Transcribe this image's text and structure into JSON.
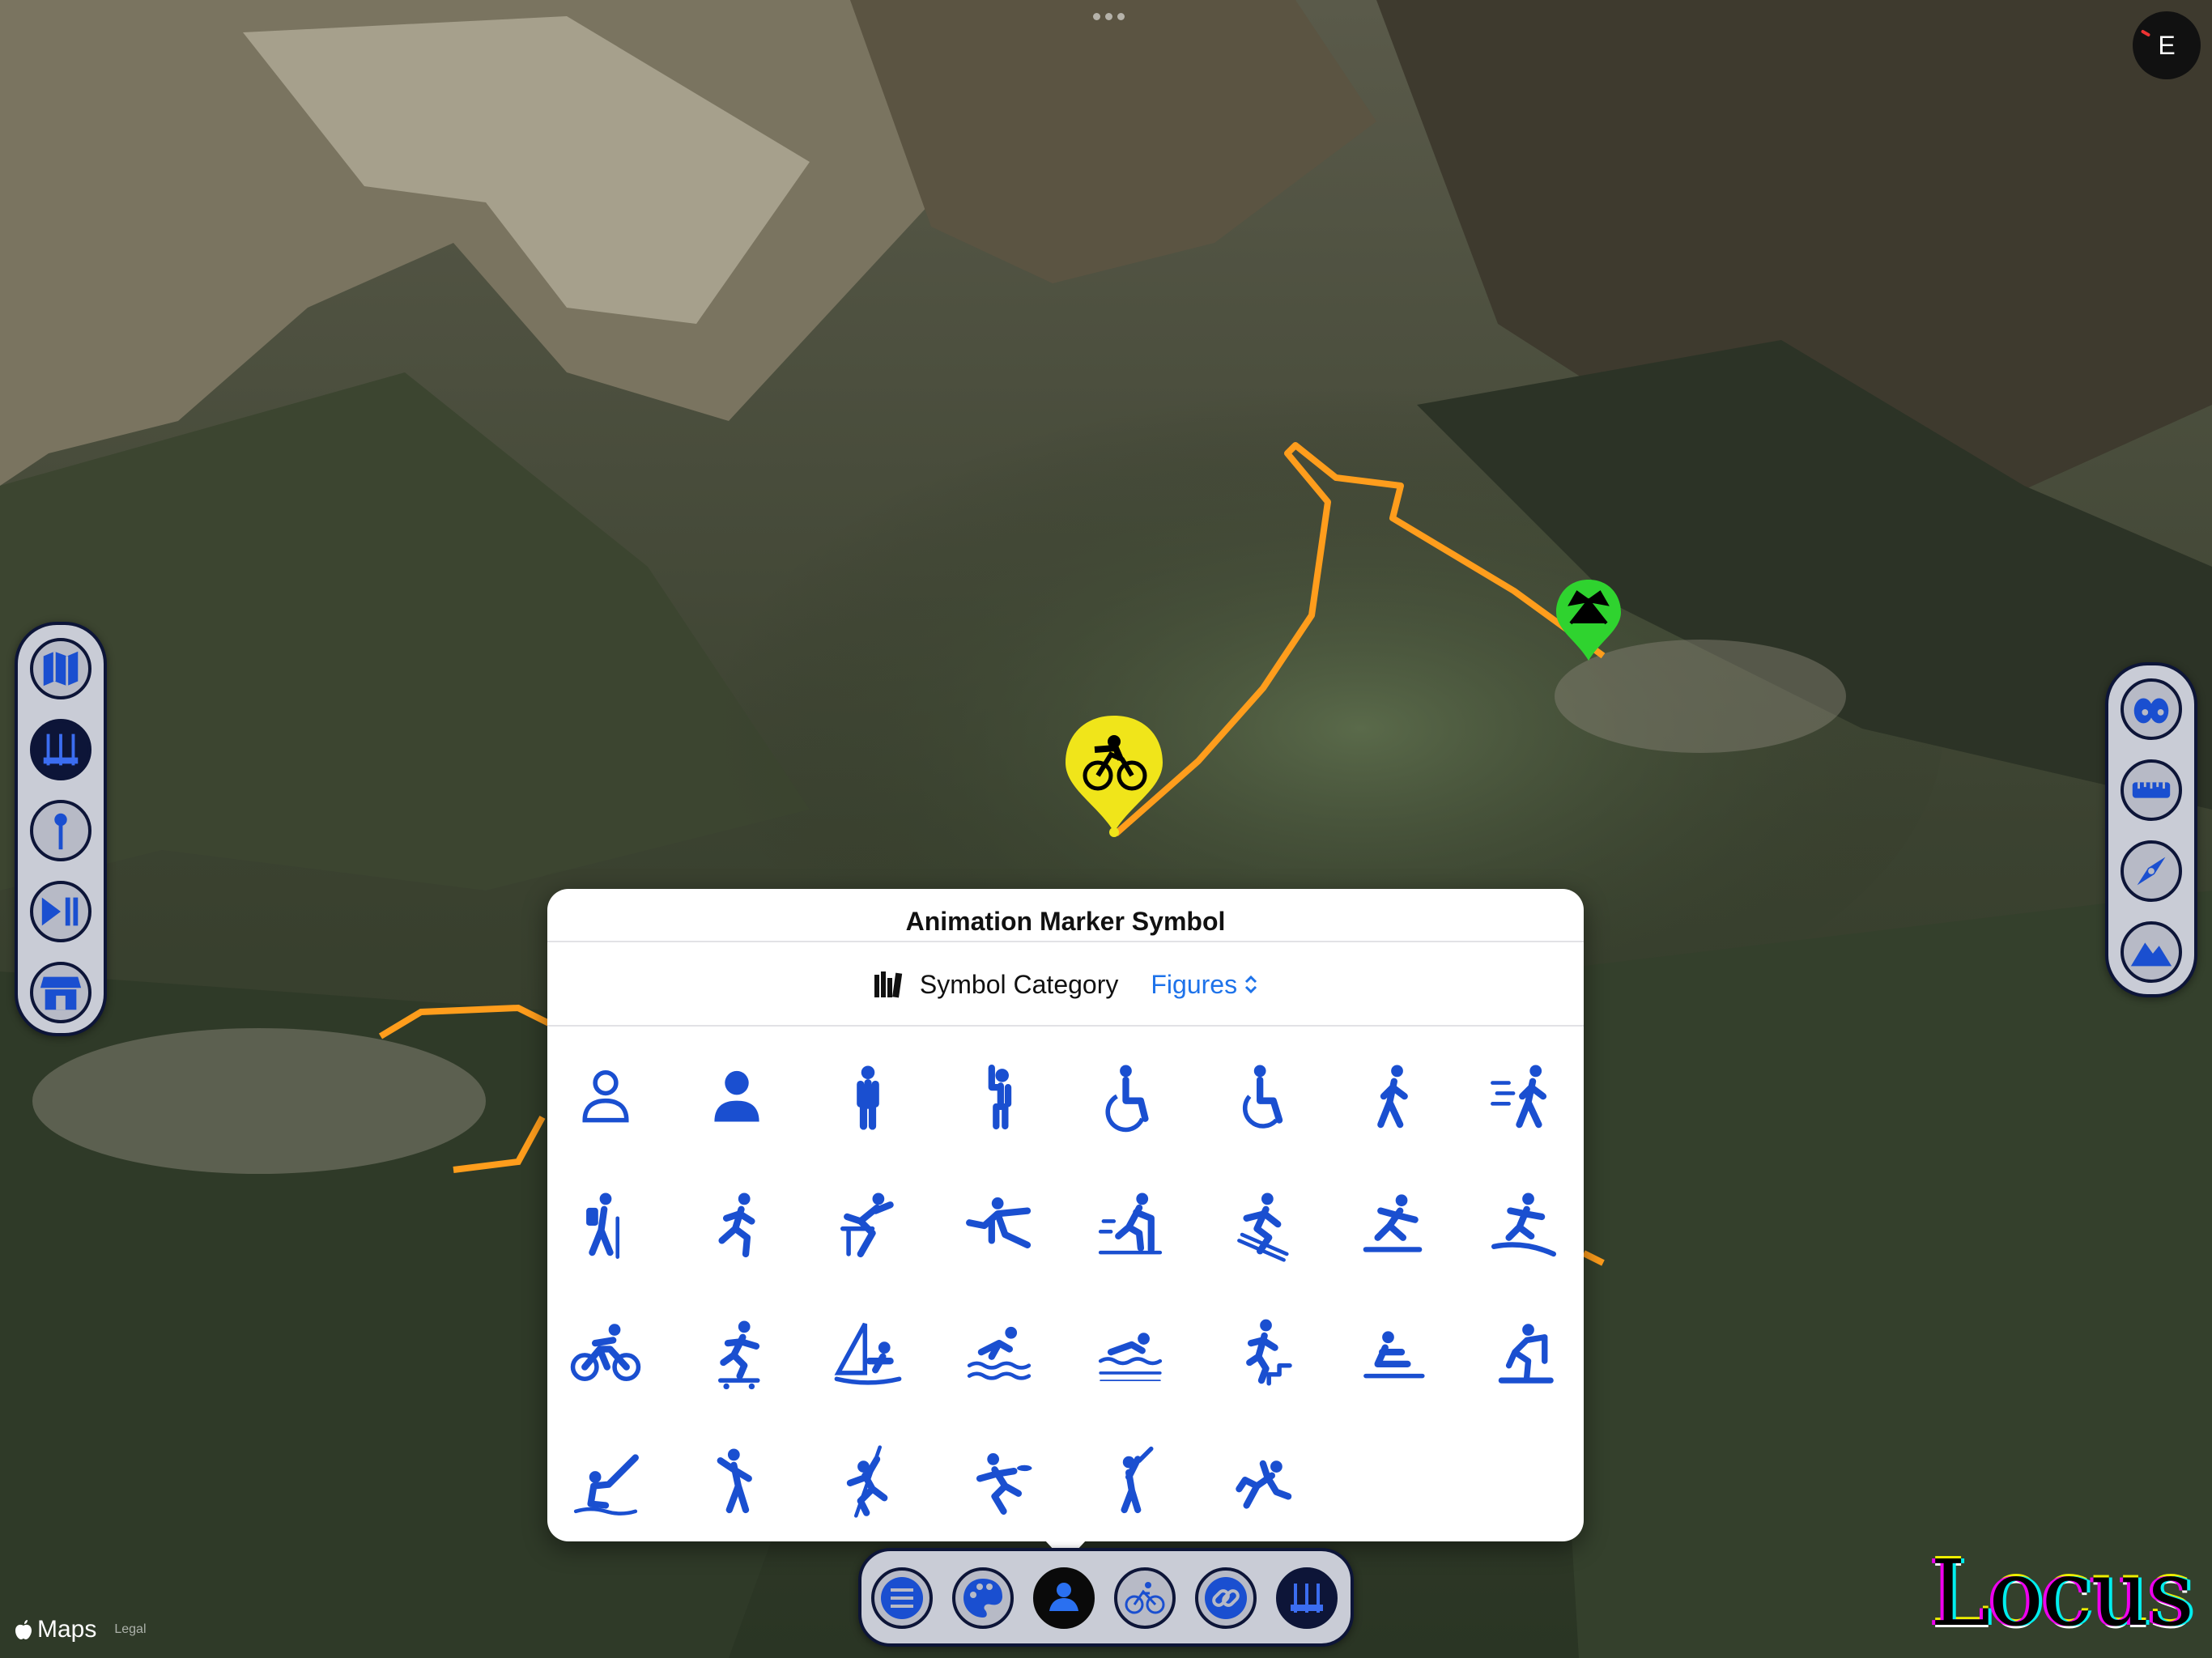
{
  "popover": {
    "title": "Animation Marker Symbol",
    "category_label": "Symbol Category",
    "category_value": "Figures",
    "symbols": [
      "person-outline",
      "person-fill",
      "person-standing",
      "person-arms-up",
      "wheelchair",
      "wheelchair-motion",
      "figure-walk",
      "figure-walk-motion",
      "hiking",
      "running",
      "hurdles",
      "martial-arts",
      "cross-country-skiing",
      "downhill-skiing",
      "snowboarding",
      "surfing",
      "cycling",
      "skateboarding",
      "sailing",
      "swimming",
      "pool-swimming",
      "stairs",
      "rowing",
      "indoor-cycle",
      "fishing",
      "dance",
      "pole-climbing",
      "frisbee",
      "baseball",
      "falling"
    ]
  },
  "compass": {
    "label": "E"
  },
  "left_toolbar": [
    "map-icon",
    "guitar-tools-icon",
    "pin-icon",
    "play-pause-icon",
    "storefront-icon"
  ],
  "right_toolbar": [
    "binoculars-icon",
    "ruler-icon",
    "compass-icon",
    "mountains-icon"
  ],
  "dock": [
    "list-icon",
    "palette-icon",
    "person-icon",
    "bicycle-icon",
    "link-icon",
    "guitar-tools-icon"
  ],
  "map_attribution": {
    "maps": "Maps",
    "legal": "Legal"
  },
  "brand": {
    "text": "Locus"
  },
  "colors": {
    "accent": "#1e73ea",
    "symbol_blue": "#1a4fd0",
    "route": "#ff9d1c",
    "dock_navy": "#0d1538"
  }
}
